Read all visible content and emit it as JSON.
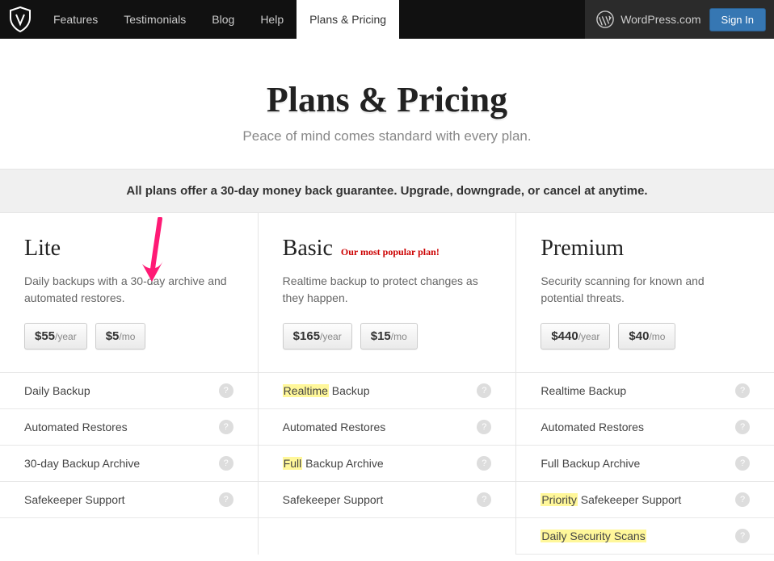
{
  "nav": {
    "items": [
      "Features",
      "Testimonials",
      "Blog",
      "Help",
      "Plans & Pricing"
    ],
    "active_index": 4,
    "wordpress": "WordPress.com",
    "signin": "Sign In"
  },
  "hero": {
    "title": "Plans & Pricing",
    "subtitle": "Peace of mind comes standard with every plan."
  },
  "banner": "All plans offer a 30-day money back guarantee. Upgrade, downgrade, or cancel at anytime.",
  "plans": [
    {
      "name": "Lite",
      "badge": "",
      "desc": "Daily backups with a 30-day archive and automated restores.",
      "price_year": {
        "amt": "$55",
        "per": "/year"
      },
      "price_month": {
        "amt": "$5",
        "per": "/mo"
      },
      "features": [
        {
          "text_pre": "",
          "hl": "",
          "text_post": "Daily Backup"
        },
        {
          "text_pre": "",
          "hl": "",
          "text_post": "Automated Restores"
        },
        {
          "text_pre": "",
          "hl": "",
          "text_post": "30-day Backup Archive"
        },
        {
          "text_pre": "",
          "hl": "",
          "text_post": "Safekeeper Support"
        }
      ]
    },
    {
      "name": "Basic",
      "badge": "Our most popular plan!",
      "desc": "Realtime backup to protect changes as they happen.",
      "price_year": {
        "amt": "$165",
        "per": "/year"
      },
      "price_month": {
        "amt": "$15",
        "per": "/mo"
      },
      "features": [
        {
          "text_pre": "",
          "hl": "Realtime",
          "text_post": " Backup"
        },
        {
          "text_pre": "",
          "hl": "",
          "text_post": "Automated Restores"
        },
        {
          "text_pre": "",
          "hl": "Full",
          "text_post": " Backup Archive"
        },
        {
          "text_pre": "",
          "hl": "",
          "text_post": "Safekeeper Support"
        }
      ]
    },
    {
      "name": "Premium",
      "badge": "",
      "desc": "Security scanning for known and potential threats.",
      "price_year": {
        "amt": "$440",
        "per": "/year"
      },
      "price_month": {
        "amt": "$40",
        "per": "/mo"
      },
      "features": [
        {
          "text_pre": "",
          "hl": "",
          "text_post": "Realtime Backup"
        },
        {
          "text_pre": "",
          "hl": "",
          "text_post": "Automated Restores"
        },
        {
          "text_pre": "",
          "hl": "",
          "text_post": "Full Backup Archive"
        },
        {
          "text_pre": "",
          "hl": "Priority",
          "text_post": " Safekeeper Support"
        },
        {
          "text_pre": "",
          "hl": "Daily Security Scans",
          "text_post": ""
        }
      ]
    }
  ]
}
